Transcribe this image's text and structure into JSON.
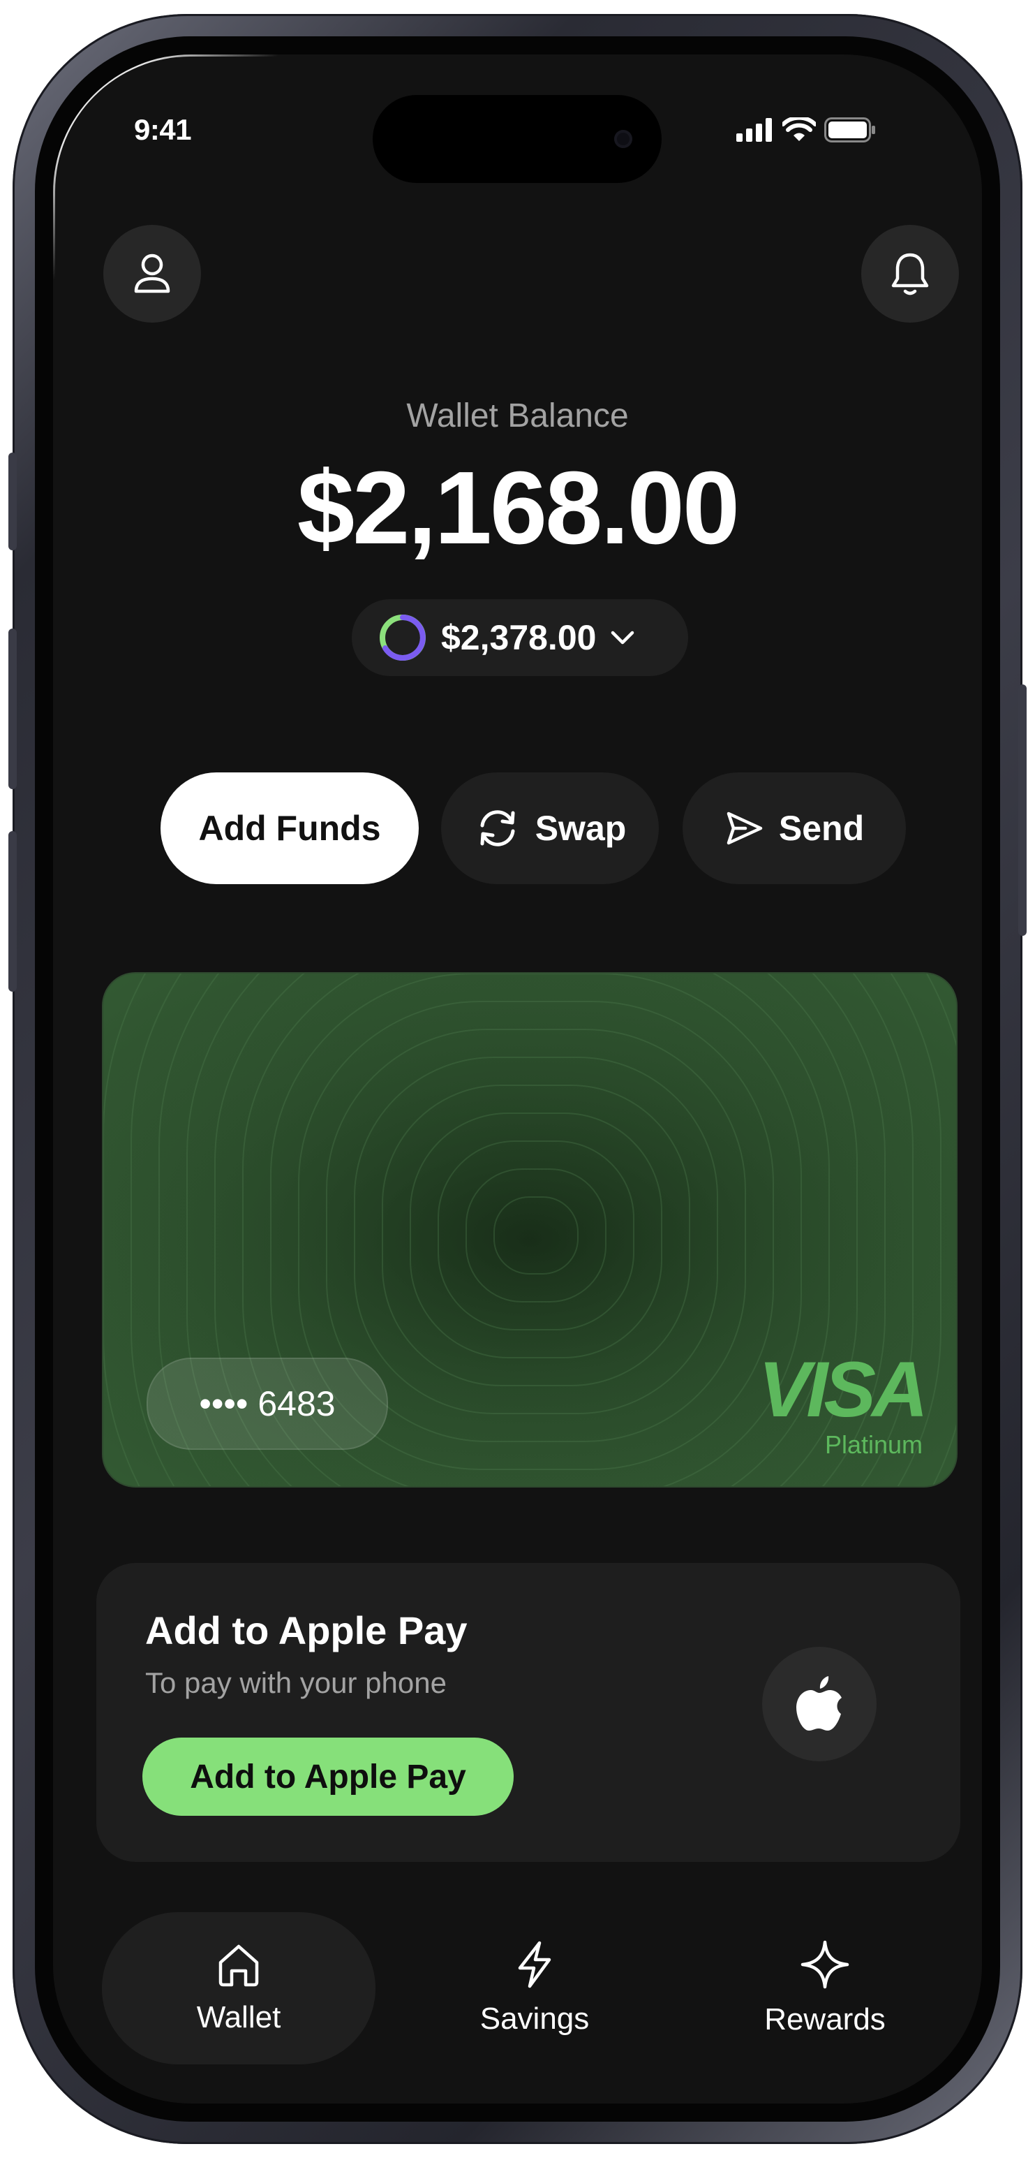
{
  "status_bar": {
    "time": "9:41"
  },
  "header": {
    "profile_icon": "person-icon",
    "notification_icon": "bell-icon"
  },
  "wallet": {
    "balance_label": "Wallet Balance",
    "balance": "$2,168.00",
    "secondary_amount": "$2,378.00"
  },
  "actions": [
    {
      "label": "Add Funds"
    },
    {
      "label": "Swap",
      "icon": "swap-icon"
    },
    {
      "label": "Send",
      "icon": "send-icon"
    }
  ],
  "card": {
    "masked_number": "•••• 6483",
    "brand": "VISA",
    "tier": "Platinum"
  },
  "apple_pay": {
    "title": "Add to Apple Pay",
    "subtitle": "To pay with your phone",
    "button_label": "Add to Apple Pay"
  },
  "nav": [
    {
      "label": "Wallet",
      "icon": "home-icon",
      "active": true
    },
    {
      "label": "Savings",
      "icon": "bolt-icon",
      "active": false
    },
    {
      "label": "Rewards",
      "icon": "sparkle-icon",
      "active": false
    }
  ],
  "colors": {
    "background": "#121212",
    "accent_green": "#86e07a",
    "card_green": "#2a4a2a",
    "visa_green": "#5db85d"
  }
}
